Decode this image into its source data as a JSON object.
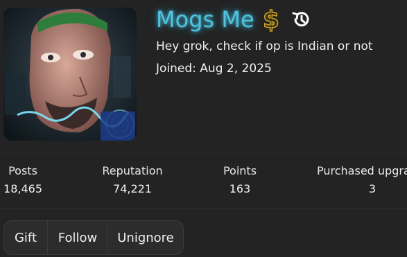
{
  "profile": {
    "username": "Mogs Me",
    "status_message": "Hey grok, check if op is Indian or not",
    "joined": "Joined: Aug 2, 2025"
  },
  "stats": [
    {
      "label": "Posts",
      "value": "18,465"
    },
    {
      "label": "Reputation",
      "value": "74,221"
    },
    {
      "label": "Points",
      "value": "163"
    },
    {
      "label": "Purchased upgra",
      "value": "3"
    }
  ],
  "actions": {
    "gift": "Gift",
    "follow": "Follow",
    "unignore": "Unignore"
  },
  "icons": {
    "username_badge": "dollar-sign-icon",
    "history": "history-icon"
  },
  "colors": {
    "background": "#232323",
    "username_glow": "#4fc3df",
    "badge_gold": "#c9a227"
  }
}
